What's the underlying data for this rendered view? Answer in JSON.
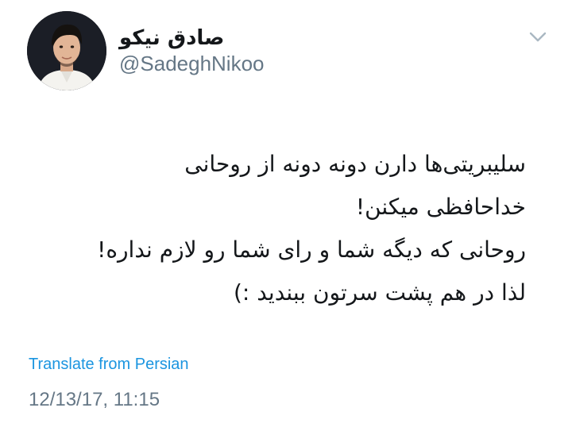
{
  "author": {
    "display_name": "صادق نیکو",
    "handle": "@SadeghNikoo",
    "avatar_icon": "profile-photo",
    "menu_icon": "chevron-down-icon"
  },
  "tweet": {
    "lines": [
      "سلیبریتی‌ها دارن دونه دونه از روحانی",
      "خداحافظی میکنن!",
      "روحانی که دیگه شما و رای شما رو لازم نداره!",
      "لذا در هم پشت سرتون ببندید :)"
    ],
    "translate_label": "Translate from Persian",
    "timestamp": "12/13/17, 11:15"
  },
  "colors": {
    "text": "#14171a",
    "secondary": "#657786",
    "link": "#1b95e0",
    "background": "#ffffff"
  }
}
